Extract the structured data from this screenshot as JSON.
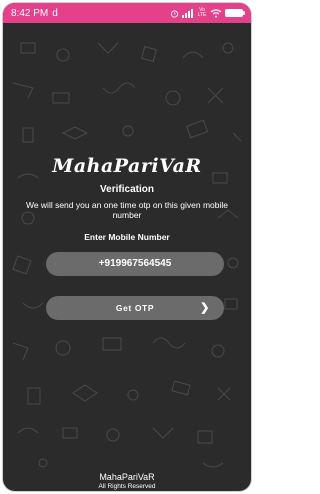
{
  "status_bar": {
    "time": "8:42 PM",
    "notification_glyph": "d",
    "icons": [
      "alarm-icon",
      "signal-icon",
      "volte-icon",
      "wifi-icon",
      "battery-icon"
    ],
    "network_label": "Vo LTE",
    "accent_color": "#e5408a"
  },
  "app": {
    "logo_text": "MahaPariVaR",
    "title": "Verification",
    "description": "We will send you an one time otp on this given mobile number",
    "mobile_label": "Enter Mobile Number",
    "mobile_value": "+919967564545",
    "get_otp_label": "Get OTP",
    "get_otp_icon": "chevron-right-icon",
    "background_color": "#2b2b2b",
    "button_color": "#6b6b6b"
  },
  "footer": {
    "app_name": "MahaPariVaR",
    "copyright": "All Rights Reserved"
  }
}
